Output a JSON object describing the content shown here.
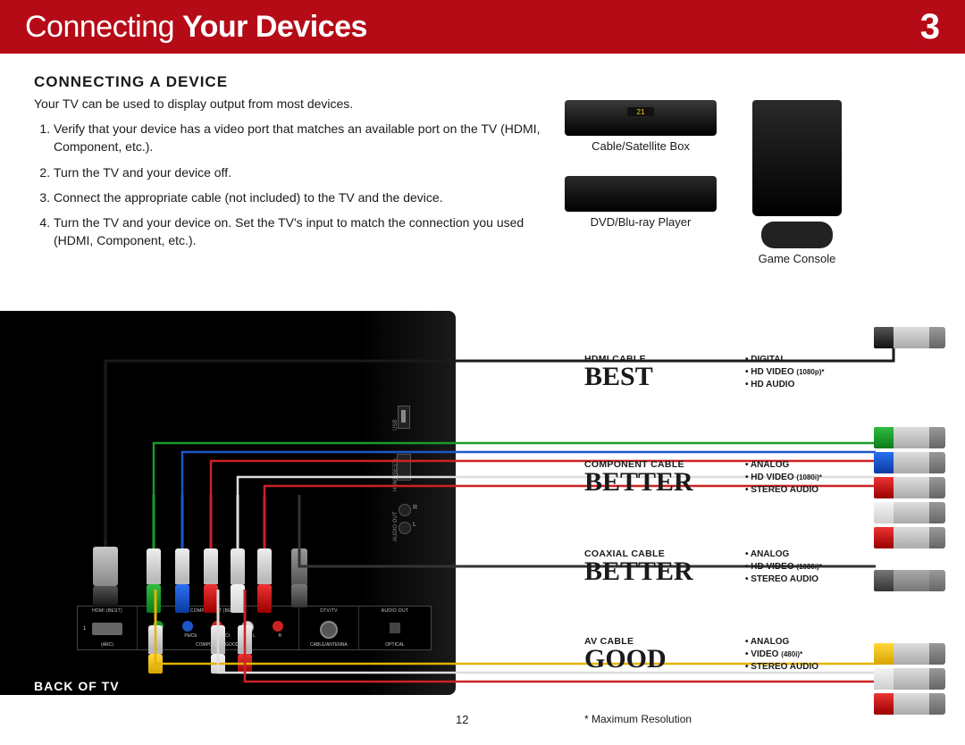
{
  "header": {
    "title_light": "Connecting",
    "title_bold": "Your Devices",
    "chapter": "3"
  },
  "section": {
    "title": "CONNECTING A DEVICE",
    "intro": "Your TV can be used to display output from most devices.",
    "steps": [
      "Verify that your device has a video port that matches an available port on the TV (HDMI, Component, etc.).",
      "Turn the TV and your device off.",
      "Connect the appropriate cable (not included) to the TV and the device.",
      "Turn the TV and your device on. Set the TV's input to match the connection you used (HDMI, Component, etc.)."
    ]
  },
  "devices": {
    "cable_box": "Cable/Satellite Box",
    "cable_display": "21",
    "dvd": "DVD/Blu-ray Player",
    "console": "Game Console"
  },
  "back_label": "BACK OF TV",
  "side_labels": {
    "usb": "USB",
    "hdmi": "HDMI (BEST)",
    "audio": "AUDIO OUT",
    "r": "R",
    "l": "L"
  },
  "port_panel": {
    "hdmi": {
      "top": "HDMI (BEST)",
      "sub": "(ARC)",
      "n": "1"
    },
    "component": {
      "top": "COMPONENT (BETTER)",
      "sub": "COMPOSITE (GOOD)",
      "y": "Y/V",
      "pb": "Pb/Cb",
      "pr": "Pr/Cr",
      "l": "L",
      "r": "R"
    },
    "dtv": {
      "top": "DTV/TV",
      "sub": "CABLE/ANTENNA"
    },
    "audio_out": {
      "top": "AUDIO OUT",
      "sub": "OPTICAL"
    }
  },
  "quality": [
    {
      "name": "HDMI CABLE",
      "rank": "BEST",
      "bullets": [
        "DIGITAL",
        "HD VIDEO",
        "HD AUDIO"
      ],
      "res": "(1080p)*"
    },
    {
      "name": "COMPONENT CABLE",
      "rank": "BETTER",
      "bullets": [
        "ANALOG",
        "HD VIDEO",
        "STEREO AUDIO"
      ],
      "res": "(1080i)*"
    },
    {
      "name": "COAXIAL CABLE",
      "rank": "BETTER",
      "bullets": [
        "ANALOG",
        "HD VIDEO",
        "STEREO AUDIO"
      ],
      "res": "(1080i)*"
    },
    {
      "name": "AV CABLE",
      "rank": "GOOD",
      "bullets": [
        "ANALOG",
        "VIDEO",
        "STEREO AUDIO"
      ],
      "res": "(480i)*"
    }
  ],
  "footnote": "* Maximum Resolution",
  "page_num": "12"
}
